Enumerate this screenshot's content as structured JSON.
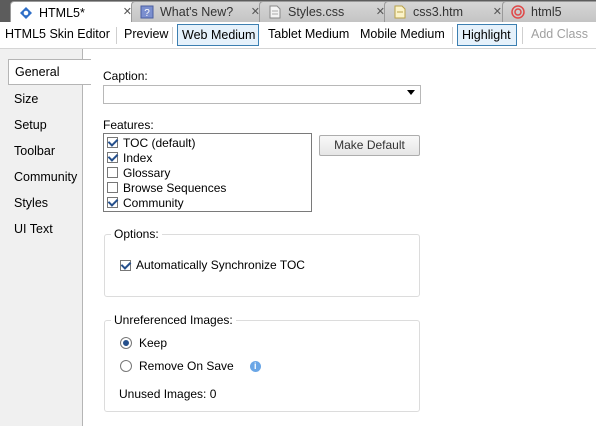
{
  "tabs": [
    {
      "label": "HTML5*",
      "icon": "html5-skin-icon",
      "active": true
    },
    {
      "label": "What's New?",
      "icon": "help-topic-icon",
      "active": false
    },
    {
      "label": "Styles.css",
      "icon": "stylesheet-icon",
      "active": false
    },
    {
      "label": "css3.htm",
      "icon": "html-file-icon",
      "active": false
    },
    {
      "label": "html5",
      "icon": "target-icon",
      "active": false
    }
  ],
  "toolbar": {
    "editor_title": "HTML5 Skin Editor",
    "preview": "Preview",
    "web_medium": "Web Medium",
    "tablet_medium": "Tablet Medium",
    "mobile_medium": "Mobile Medium",
    "highlight": "Highlight",
    "add_class": "Add Class"
  },
  "nav": [
    "General",
    "Size",
    "Setup",
    "Toolbar",
    "Community",
    "Styles",
    "UI Text"
  ],
  "nav_selected": "General",
  "caption": {
    "label": "Caption:",
    "value": ""
  },
  "features": {
    "label": "Features:",
    "items": [
      {
        "label": "TOC (default)",
        "checked": true
      },
      {
        "label": "Index",
        "checked": true
      },
      {
        "label": "Glossary",
        "checked": false
      },
      {
        "label": "Browse Sequences",
        "checked": false
      },
      {
        "label": "Community",
        "checked": true
      }
    ],
    "make_default": "Make Default"
  },
  "options": {
    "title": "Options:",
    "auto_sync_label": "Automatically Synchronize TOC",
    "auto_sync_checked": true
  },
  "unreferenced": {
    "title": "Unreferenced Images:",
    "keep": "Keep",
    "remove": "Remove On Save",
    "selected": "Keep",
    "unused_label": "Unused Images: 0"
  },
  "colors": {
    "tab_strip": "#5c5c5c",
    "toggle_border": "#3c7fb1",
    "check_mark": "#26508c",
    "info_icon": "#6aa6e6"
  }
}
